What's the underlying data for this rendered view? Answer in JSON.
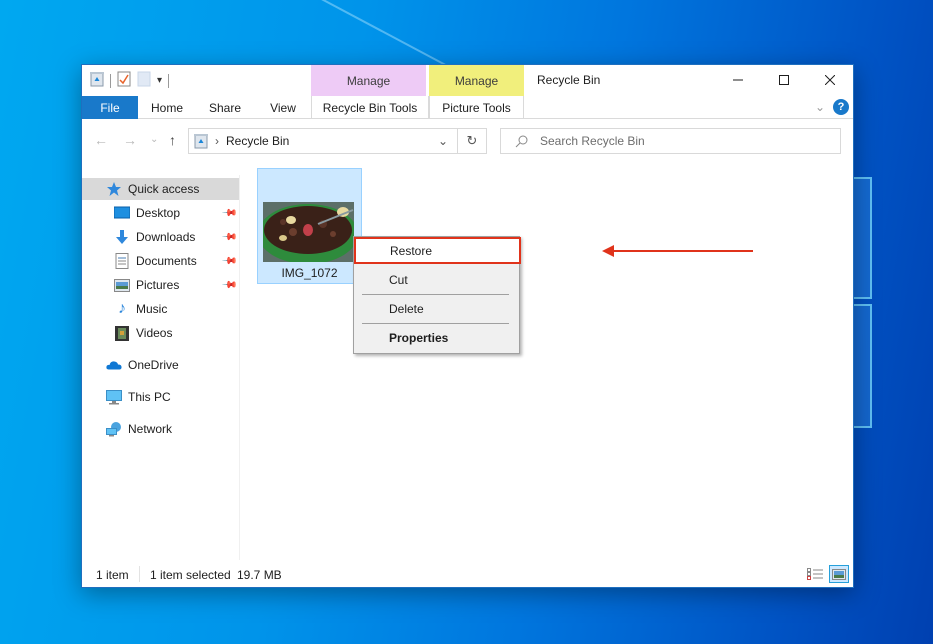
{
  "window": {
    "title": "Recycle Bin",
    "quick_access_toolbar": [
      "recycle-bin-icon",
      "properties-checkmark-icon",
      "new-folder-icon",
      "customize-dropdown-icon"
    ],
    "caption_buttons": {
      "minimize": "—",
      "maximize": "☐",
      "close": "✕"
    }
  },
  "ribbon": {
    "tabs": [
      {
        "label": "File",
        "active": true
      },
      {
        "label": "Home"
      },
      {
        "label": "Share"
      },
      {
        "label": "View"
      }
    ],
    "contextual_tabs": [
      {
        "group": "Manage",
        "label": "Recycle Bin Tools",
        "color": "#eecbf6"
      },
      {
        "group": "Manage",
        "label": "Picture Tools",
        "color": "#f1ef7c"
      }
    ],
    "expand_icon": "⌄",
    "help_label": "?"
  },
  "nav": {
    "back": "←",
    "forward": "→",
    "recent": "⌄",
    "up": "↑",
    "breadcrumb_sep": "›",
    "location": "Recycle Bin",
    "address_dropdown": "⌄",
    "refresh": "↻",
    "search_placeholder": "Search Recycle Bin",
    "search_icon": "⚲"
  },
  "sidebar": {
    "items": [
      {
        "label": "Quick access",
        "icon": "star-icon",
        "selected": true
      },
      {
        "label": "Desktop",
        "icon": "desktop-icon",
        "pinned": true
      },
      {
        "label": "Downloads",
        "icon": "downloads-icon",
        "pinned": true
      },
      {
        "label": "Documents",
        "icon": "documents-icon",
        "pinned": true
      },
      {
        "label": "Pictures",
        "icon": "pictures-icon",
        "pinned": true
      },
      {
        "label": "Music",
        "icon": "music-icon"
      },
      {
        "label": "Videos",
        "icon": "videos-icon"
      },
      {
        "label": "OneDrive",
        "icon": "onedrive-icon"
      },
      {
        "label": "This PC",
        "icon": "this-pc-icon"
      },
      {
        "label": "Network",
        "icon": "network-icon"
      }
    ],
    "pin_glyph": "📌"
  },
  "content": {
    "files": [
      {
        "name": "IMG_1072",
        "selected": true
      }
    ]
  },
  "context_menu": {
    "items": [
      {
        "label": "Restore",
        "highlighted": true
      },
      {
        "label": "Cut"
      },
      {
        "label": "Delete"
      },
      {
        "label": "Properties",
        "bold": true
      }
    ],
    "annotation_color": "#e0331b"
  },
  "status": {
    "item_count": "1 item",
    "selection": "1 item selected",
    "size": "19.7 MB"
  }
}
